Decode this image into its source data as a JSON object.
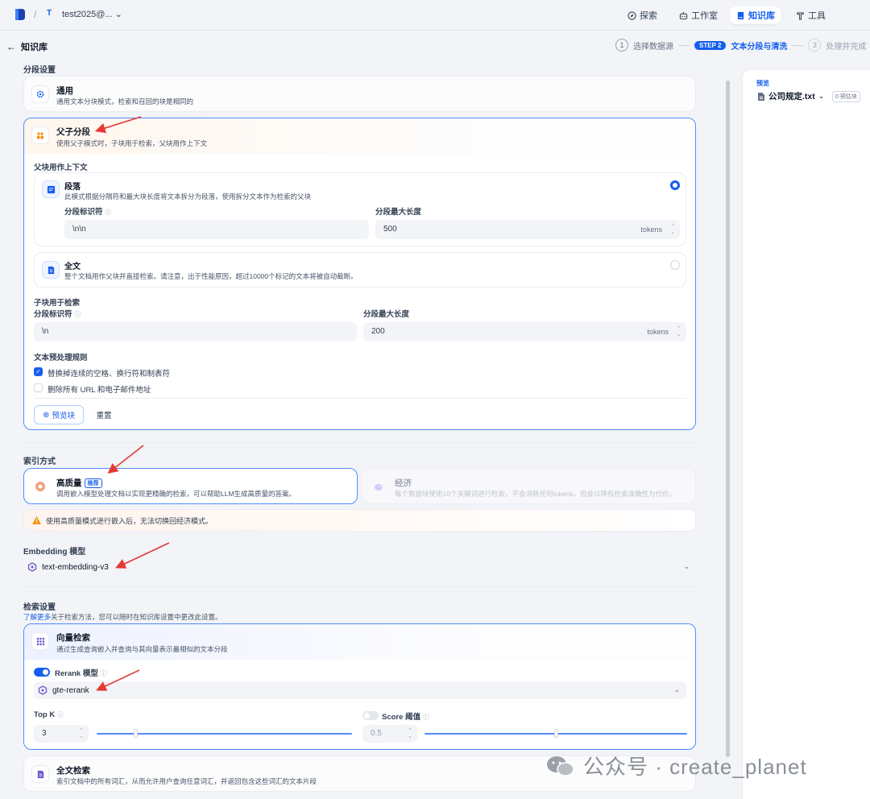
{
  "nav": {
    "workspace_initial": "T",
    "workspace_name": "test2025@...",
    "items": [
      {
        "label": "探索",
        "icon": "compass-icon"
      },
      {
        "label": "工作室",
        "icon": "robot-icon"
      },
      {
        "label": "知识库",
        "icon": "book-icon"
      },
      {
        "label": "工具",
        "icon": "tools-icon"
      }
    ]
  },
  "header": {
    "back_label": "知识库",
    "steps": [
      {
        "num": "1",
        "label": "选择数据源"
      },
      {
        "num": "STEP 2",
        "label": "文本分段与清洗"
      },
      {
        "num": "3",
        "label": "处理并完成"
      }
    ]
  },
  "segmentation": {
    "title": "分段设置",
    "general": {
      "title": "通用",
      "desc": "通用文本分块模式，检索和召回的块是相同的"
    },
    "parent_child": {
      "title": "父子分段",
      "desc": "使用父子模式时，子块用于检索，父块用作上下文"
    },
    "parent_section_title": "父块用作上下文",
    "paragraph": {
      "title": "段落",
      "desc": "此模式根据分隔符和最大块长度将文本拆分为段落，使用拆分文本作为检索的父块",
      "delimiter_label": "分段标识符",
      "delimiter_value": "\\n\\n",
      "maxlen_label": "分段最大长度",
      "maxlen_value": "500",
      "unit": "tokens"
    },
    "fulltext": {
      "title": "全文",
      "desc": "整个文档用作父块并直接检索。请注意，出于性能原因，超过10000个标记的文本将被自动截断。"
    },
    "child_section_title": "子块用于检索",
    "child": {
      "delimiter_label": "分段标识符",
      "delimiter_value": "\\n",
      "maxlen_label": "分段最大长度",
      "maxlen_value": "200",
      "unit": "tokens"
    },
    "preprocess_title": "文本预处理规则",
    "rule1": "替换掉连续的空格、换行符和制表符",
    "rule2": "删除所有 URL 和电子邮件地址",
    "preview_btn": "预览块",
    "reset_btn": "重置"
  },
  "index": {
    "title": "索引方式",
    "high": {
      "title": "高质量",
      "badge": "推荐",
      "desc": "调用嵌入模型处理文档以实现更精确的检索，可以帮助LLM生成高质量的答案。"
    },
    "eco": {
      "title": "经济",
      "desc": "每个数据块使用10个关键词进行检索，不会消耗任何tokens，但会以降低检索准确性为代价。"
    },
    "warning": "使用高质量模式进行嵌入后，无法切换回经济模式。"
  },
  "embedding": {
    "title": "Embedding 模型",
    "model": "text-embedding-v3"
  },
  "retrieval": {
    "title": "检索设置",
    "learn_more": "了解更多",
    "learn_desc": "关于检索方法，您可以随时在知识库设置中更改此设置。",
    "vector": {
      "title": "向量检索",
      "desc": "通过生成查询嵌入并查询与其向量表示最相似的文本分段"
    },
    "rerank_label": "Rerank 模型",
    "rerank_model": "gte-rerank",
    "topk_label": "Top K",
    "topk_value": "3",
    "topk_fraction": 0.15,
    "score_label": "Score 阈值",
    "score_value": "0.5",
    "score_fraction": 0.5,
    "fulltext": {
      "title": "全文检索",
      "desc": "索引文档中的所有词汇，从而允许用户查询任意词汇，并返回包含这些词汇的文本片段"
    }
  },
  "preview": {
    "label": "预览",
    "file": "公司规定.txt",
    "count": "0 预估块"
  },
  "watermark": "公众号 · create_planet"
}
